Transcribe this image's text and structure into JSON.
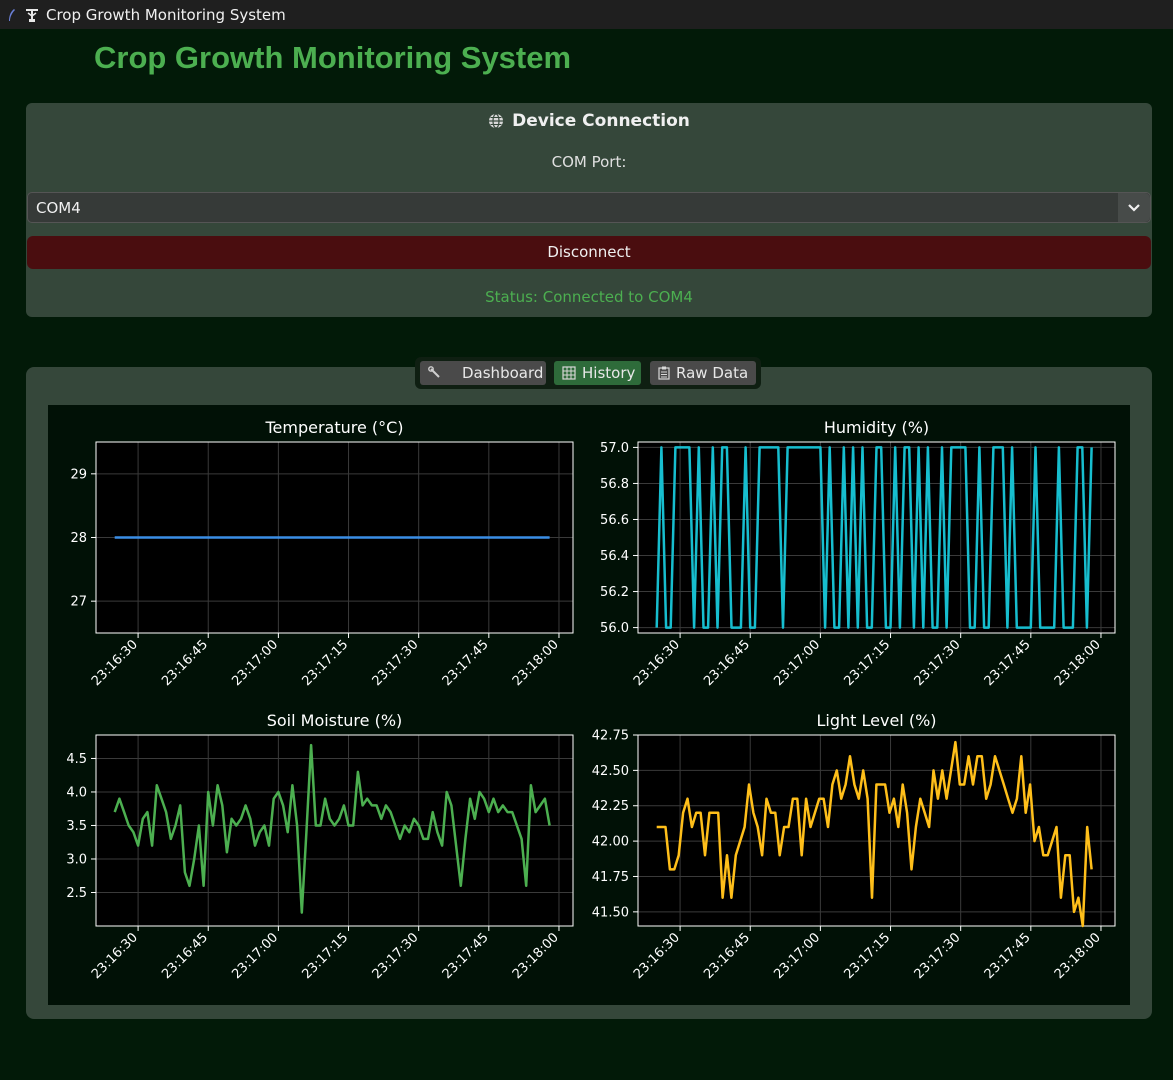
{
  "window": {
    "title": "Crop Growth Monitoring System"
  },
  "app": {
    "title": "Crop Growth Monitoring System"
  },
  "connection": {
    "title": "Device Connection",
    "com_label": "COM Port:",
    "selected_port": "COM4",
    "disconnect_label": "Disconnect",
    "status": "Status: Connected to COM4"
  },
  "tabs": [
    {
      "label": "Dashboard",
      "icon": "wrench-icon"
    },
    {
      "label": "History",
      "icon": "chart-icon",
      "active": true
    },
    {
      "label": "Raw Data",
      "icon": "clipboard-icon"
    }
  ],
  "colors": {
    "brand_green": "#4caf50",
    "temperature": "#3a8ee6",
    "humidity": "#17becf",
    "soil": "#4caf50",
    "light": "#ffbf1a",
    "disconnect": "#4a0d0f"
  },
  "chart_data": [
    {
      "type": "line",
      "title": "Temperature (°C)",
      "color": "#3a8ee6",
      "x_ticks": [
        "23:16:30",
        "23:16:45",
        "23:17:00",
        "23:17:15",
        "23:17:30",
        "23:17:45",
        "23:18:00"
      ],
      "ylim": [
        26.5,
        29.5
      ],
      "y_ticks": [
        "27",
        "28",
        "29"
      ],
      "y_tick_values": [
        27,
        28,
        29
      ],
      "x_range_seconds": [
        "23:16:25",
        "23:17:58"
      ],
      "grid": true,
      "values": [
        28,
        28,
        28,
        28,
        28,
        28,
        28,
        28,
        28,
        28,
        28,
        28,
        28,
        28,
        28,
        28,
        28,
        28,
        28,
        28,
        28,
        28,
        28,
        28,
        28,
        28,
        28,
        28,
        28,
        28,
        28,
        28,
        28,
        28,
        28,
        28,
        28,
        28,
        28,
        28,
        28,
        28,
        28,
        28,
        28,
        28,
        28,
        28,
        28,
        28,
        28,
        28,
        28,
        28,
        28,
        28,
        28,
        28,
        28,
        28,
        28,
        28,
        28,
        28,
        28,
        28,
        28,
        28,
        28,
        28,
        28,
        28,
        28,
        28,
        28,
        28,
        28,
        28,
        28,
        28,
        28,
        28,
        28,
        28,
        28,
        28,
        28,
        28,
        28,
        28,
        28,
        28,
        28,
        28
      ]
    },
    {
      "type": "line",
      "title": "Humidity (%)",
      "color": "#17becf",
      "x_ticks": [
        "23:16:30",
        "23:16:45",
        "23:17:00",
        "23:17:15",
        "23:17:30",
        "23:17:45",
        "23:18:00"
      ],
      "ylim": [
        55.97,
        57.03
      ],
      "y_ticks": [
        "56.0",
        "56.2",
        "56.4",
        "56.6",
        "56.8",
        "57.0"
      ],
      "y_tick_values": [
        56.0,
        56.2,
        56.4,
        56.6,
        56.8,
        57.0
      ],
      "x_range_seconds": [
        "23:16:25",
        "23:17:58"
      ],
      "grid": true,
      "values": [
        56,
        57,
        56,
        56,
        57,
        57,
        57,
        57,
        56,
        57,
        56,
        56,
        57,
        56,
        57,
        57,
        56,
        56,
        56,
        57,
        56,
        56,
        57,
        57,
        57,
        57,
        57,
        56,
        57,
        57,
        57,
        57,
        57,
        57,
        57,
        57,
        56,
        57,
        56,
        56,
        57,
        56,
        57,
        56,
        57,
        56,
        56,
        57,
        57,
        56,
        56,
        57,
        56,
        57,
        57,
        56,
        57,
        56,
        57,
        56,
        56,
        57,
        56,
        57,
        57,
        57,
        57,
        56,
        56,
        57,
        56,
        56,
        57,
        57,
        57,
        56,
        57,
        56,
        56,
        56,
        56,
        57,
        56,
        56,
        56,
        56,
        57,
        56,
        56,
        56,
        57,
        57,
        56,
        57
      ]
    },
    {
      "type": "line",
      "title": "Soil Moisture (%)",
      "color": "#4caf50",
      "x_ticks": [
        "23:16:30",
        "23:16:45",
        "23:17:00",
        "23:17:15",
        "23:17:30",
        "23:17:45",
        "23:18:00"
      ],
      "ylim": [
        2.0,
        4.85
      ],
      "y_ticks": [
        "2.5",
        "3.0",
        "3.5",
        "4.0",
        "4.5"
      ],
      "y_tick_values": [
        2.5,
        3.0,
        3.5,
        4.0,
        4.5
      ],
      "x_range_seconds": [
        "23:16:25",
        "23:17:58"
      ],
      "grid": true,
      "values": [
        3.7,
        3.9,
        3.7,
        3.5,
        3.4,
        3.2,
        3.6,
        3.7,
        3.2,
        4.1,
        3.9,
        3.7,
        3.3,
        3.5,
        3.8,
        2.8,
        2.6,
        3.0,
        3.5,
        2.6,
        4.0,
        3.5,
        4.1,
        3.8,
        3.1,
        3.6,
        3.5,
        3.6,
        3.8,
        3.6,
        3.2,
        3.4,
        3.5,
        3.2,
        3.9,
        4.0,
        3.8,
        3.4,
        4.1,
        3.5,
        2.2,
        3.4,
        4.7,
        3.5,
        3.5,
        3.9,
        3.6,
        3.5,
        3.6,
        3.8,
        3.5,
        3.5,
        4.3,
        3.8,
        3.9,
        3.8,
        3.8,
        3.6,
        3.8,
        3.7,
        3.5,
        3.3,
        3.5,
        3.4,
        3.6,
        3.5,
        3.3,
        3.3,
        3.7,
        3.4,
        3.2,
        4.0,
        3.8,
        3.2,
        2.6,
        3.3,
        3.9,
        3.6,
        4.0,
        3.9,
        3.7,
        3.9,
        3.7,
        3.8,
        3.7,
        3.7,
        3.5,
        3.3,
        2.6,
        4.1,
        3.7,
        3.8,
        3.9,
        3.5
      ]
    },
    {
      "type": "line",
      "title": "Light Level (%)",
      "color": "#ffbf1a",
      "x_ticks": [
        "23:16:30",
        "23:16:45",
        "23:17:00",
        "23:17:15",
        "23:17:30",
        "23:17:45",
        "23:18:00"
      ],
      "ylim": [
        41.4,
        42.75
      ],
      "y_ticks": [
        "41.50",
        "41.75",
        "42.00",
        "42.25",
        "42.50",
        "42.75"
      ],
      "y_tick_values": [
        41.5,
        41.75,
        42.0,
        42.25,
        42.5,
        42.75
      ],
      "x_range_seconds": [
        "23:16:25",
        "23:17:58"
      ],
      "grid": true,
      "values": [
        42.1,
        42.1,
        42.1,
        41.8,
        41.8,
        41.9,
        42.2,
        42.3,
        42.1,
        42.2,
        42.2,
        41.9,
        42.2,
        42.2,
        42.2,
        41.6,
        41.9,
        41.6,
        41.9,
        42.0,
        42.1,
        42.4,
        42.2,
        42.1,
        41.9,
        42.3,
        42.2,
        42.2,
        41.9,
        42.1,
        42.1,
        42.3,
        42.3,
        41.9,
        42.3,
        42.1,
        42.2,
        42.3,
        42.3,
        42.1,
        42.4,
        42.5,
        42.3,
        42.4,
        42.6,
        42.4,
        42.3,
        42.5,
        42.3,
        41.6,
        42.4,
        42.4,
        42.4,
        42.2,
        42.3,
        42.1,
        42.4,
        42.2,
        41.8,
        42.1,
        42.3,
        42.2,
        42.1,
        42.5,
        42.3,
        42.5,
        42.3,
        42.5,
        42.7,
        42.4,
        42.4,
        42.6,
        42.4,
        42.6,
        42.6,
        42.3,
        42.4,
        42.6,
        42.5,
        42.4,
        42.3,
        42.2,
        42.3,
        42.6,
        42.2,
        42.4,
        42.0,
        42.1,
        41.9,
        41.9,
        42.0,
        42.1,
        41.6,
        41.9,
        41.9,
        41.5,
        41.6,
        41.4,
        42.1,
        41.8
      ]
    }
  ]
}
